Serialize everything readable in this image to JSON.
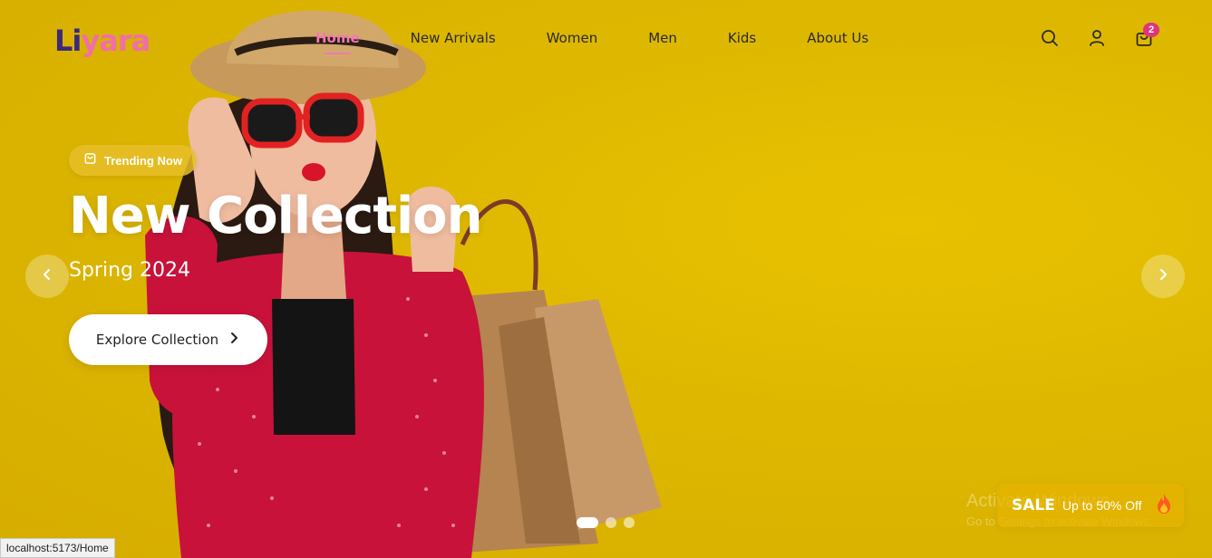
{
  "brand": {
    "logo_part1": "Li",
    "logo_part2": "yara"
  },
  "nav": {
    "items": [
      {
        "label": "Home",
        "active": true
      },
      {
        "label": "New Arrivals",
        "active": false
      },
      {
        "label": "Women",
        "active": false
      },
      {
        "label": "Men",
        "active": false
      },
      {
        "label": "Kids",
        "active": false
      },
      {
        "label": "About Us",
        "active": false
      }
    ]
  },
  "header_icons": {
    "search": "search-icon",
    "account": "user-icon",
    "cart": "shopping-bag-icon",
    "cart_count": "2"
  },
  "hero": {
    "badge_label": "Trending Now",
    "badge_icon": "shopping-bag-icon",
    "title": "New Collection",
    "subtitle": "Spring 2024",
    "cta_label": "Explore Collection",
    "cta_icon": "chevron-right-icon",
    "prev_icon": "chevron-left-icon",
    "next_icon": "chevron-right-icon",
    "slides_total": 3,
    "active_slide": 1
  },
  "sale_banner": {
    "title": "SALE",
    "subtitle": "Up to 50% Off",
    "icon": "fire-icon"
  },
  "watermark": {
    "line1": "Activate Windows",
    "line2": "Go to Settings to activate Windows."
  },
  "status_bar_url": "localhost:5173/Home",
  "colors": {
    "background": "#E3B800",
    "accent_pink": "#F07AB0",
    "logo_dark": "#3B2A7A",
    "badge": "#E0357A"
  }
}
